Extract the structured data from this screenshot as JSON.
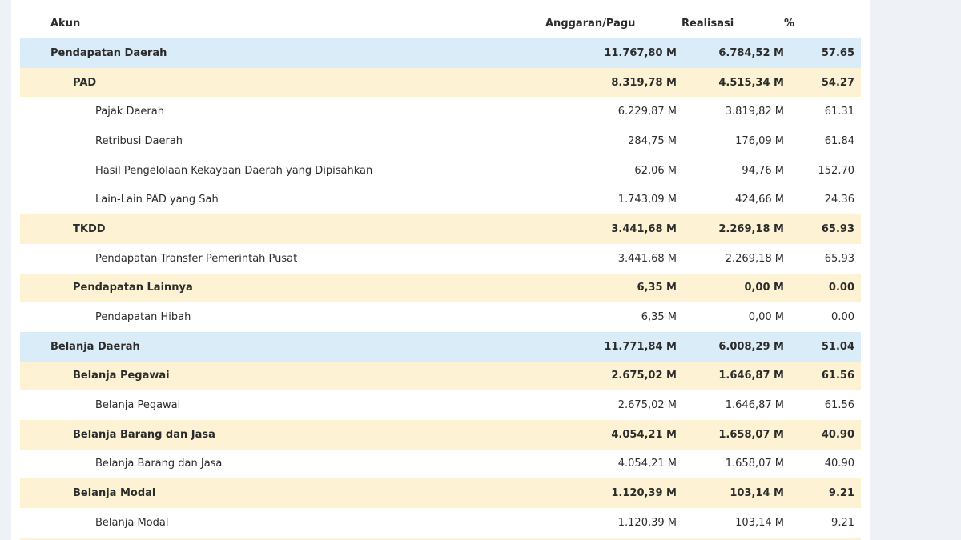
{
  "table": {
    "headers": {
      "akun": "Akun",
      "anggaran": "Anggaran/Pagu",
      "realisasi": "Realisasi",
      "persen": "%"
    },
    "rows": [
      {
        "level": 0,
        "akun": "Pendapatan Daerah",
        "anggaran": "11.767,80 M",
        "realisasi": "6.784,52 M",
        "persen": "57.65"
      },
      {
        "level": 1,
        "akun": "PAD",
        "anggaran": "8.319,78 M",
        "realisasi": "4.515,34 M",
        "persen": "54.27"
      },
      {
        "level": 2,
        "akun": "Pajak Daerah",
        "anggaran": "6.229,87 M",
        "realisasi": "3.819,82 M",
        "persen": "61.31"
      },
      {
        "level": 2,
        "akun": "Retribusi Daerah",
        "anggaran": "284,75 M",
        "realisasi": "176,09 M",
        "persen": "61.84"
      },
      {
        "level": 2,
        "akun": "Hasil Pengelolaan Kekayaan Daerah yang Dipisahkan",
        "anggaran": "62,06 M",
        "realisasi": "94,76 M",
        "persen": "152.70"
      },
      {
        "level": 2,
        "akun": "Lain-Lain PAD yang Sah",
        "anggaran": "1.743,09 M",
        "realisasi": "424,66 M",
        "persen": "24.36"
      },
      {
        "level": 1,
        "akun": "TKDD",
        "anggaran": "3.441,68 M",
        "realisasi": "2.269,18 M",
        "persen": "65.93"
      },
      {
        "level": 2,
        "akun": "Pendapatan Transfer Pemerintah Pusat",
        "anggaran": "3.441,68 M",
        "realisasi": "2.269,18 M",
        "persen": "65.93"
      },
      {
        "level": 1,
        "akun": "Pendapatan Lainnya",
        "anggaran": "6,35 M",
        "realisasi": "0,00 M",
        "persen": "0.00"
      },
      {
        "level": 2,
        "akun": "Pendapatan Hibah",
        "anggaran": "6,35 M",
        "realisasi": "0,00 M",
        "persen": "0.00"
      },
      {
        "level": 0,
        "akun": "Belanja Daerah",
        "anggaran": "11.771,84 M",
        "realisasi": "6.008,29 M",
        "persen": "51.04"
      },
      {
        "level": 1,
        "akun": "Belanja Pegawai",
        "anggaran": "2.675,02 M",
        "realisasi": "1.646,87 M",
        "persen": "61.56"
      },
      {
        "level": 2,
        "akun": "Belanja Pegawai",
        "anggaran": "2.675,02 M",
        "realisasi": "1.646,87 M",
        "persen": "61.56"
      },
      {
        "level": 1,
        "akun": "Belanja Barang dan Jasa",
        "anggaran": "4.054,21 M",
        "realisasi": "1.658,07 M",
        "persen": "40.90"
      },
      {
        "level": 2,
        "akun": "Belanja Barang dan Jasa",
        "anggaran": "4.054,21 M",
        "realisasi": "1.658,07 M",
        "persen": "40.90"
      },
      {
        "level": 1,
        "akun": "Belanja Modal",
        "anggaran": "1.120,39 M",
        "realisasi": "103,14 M",
        "persen": "9.21"
      },
      {
        "level": 2,
        "akun": "Belanja Modal",
        "anggaran": "1.120,39 M",
        "realisasi": "103,14 M",
        "persen": "9.21"
      }
    ]
  }
}
